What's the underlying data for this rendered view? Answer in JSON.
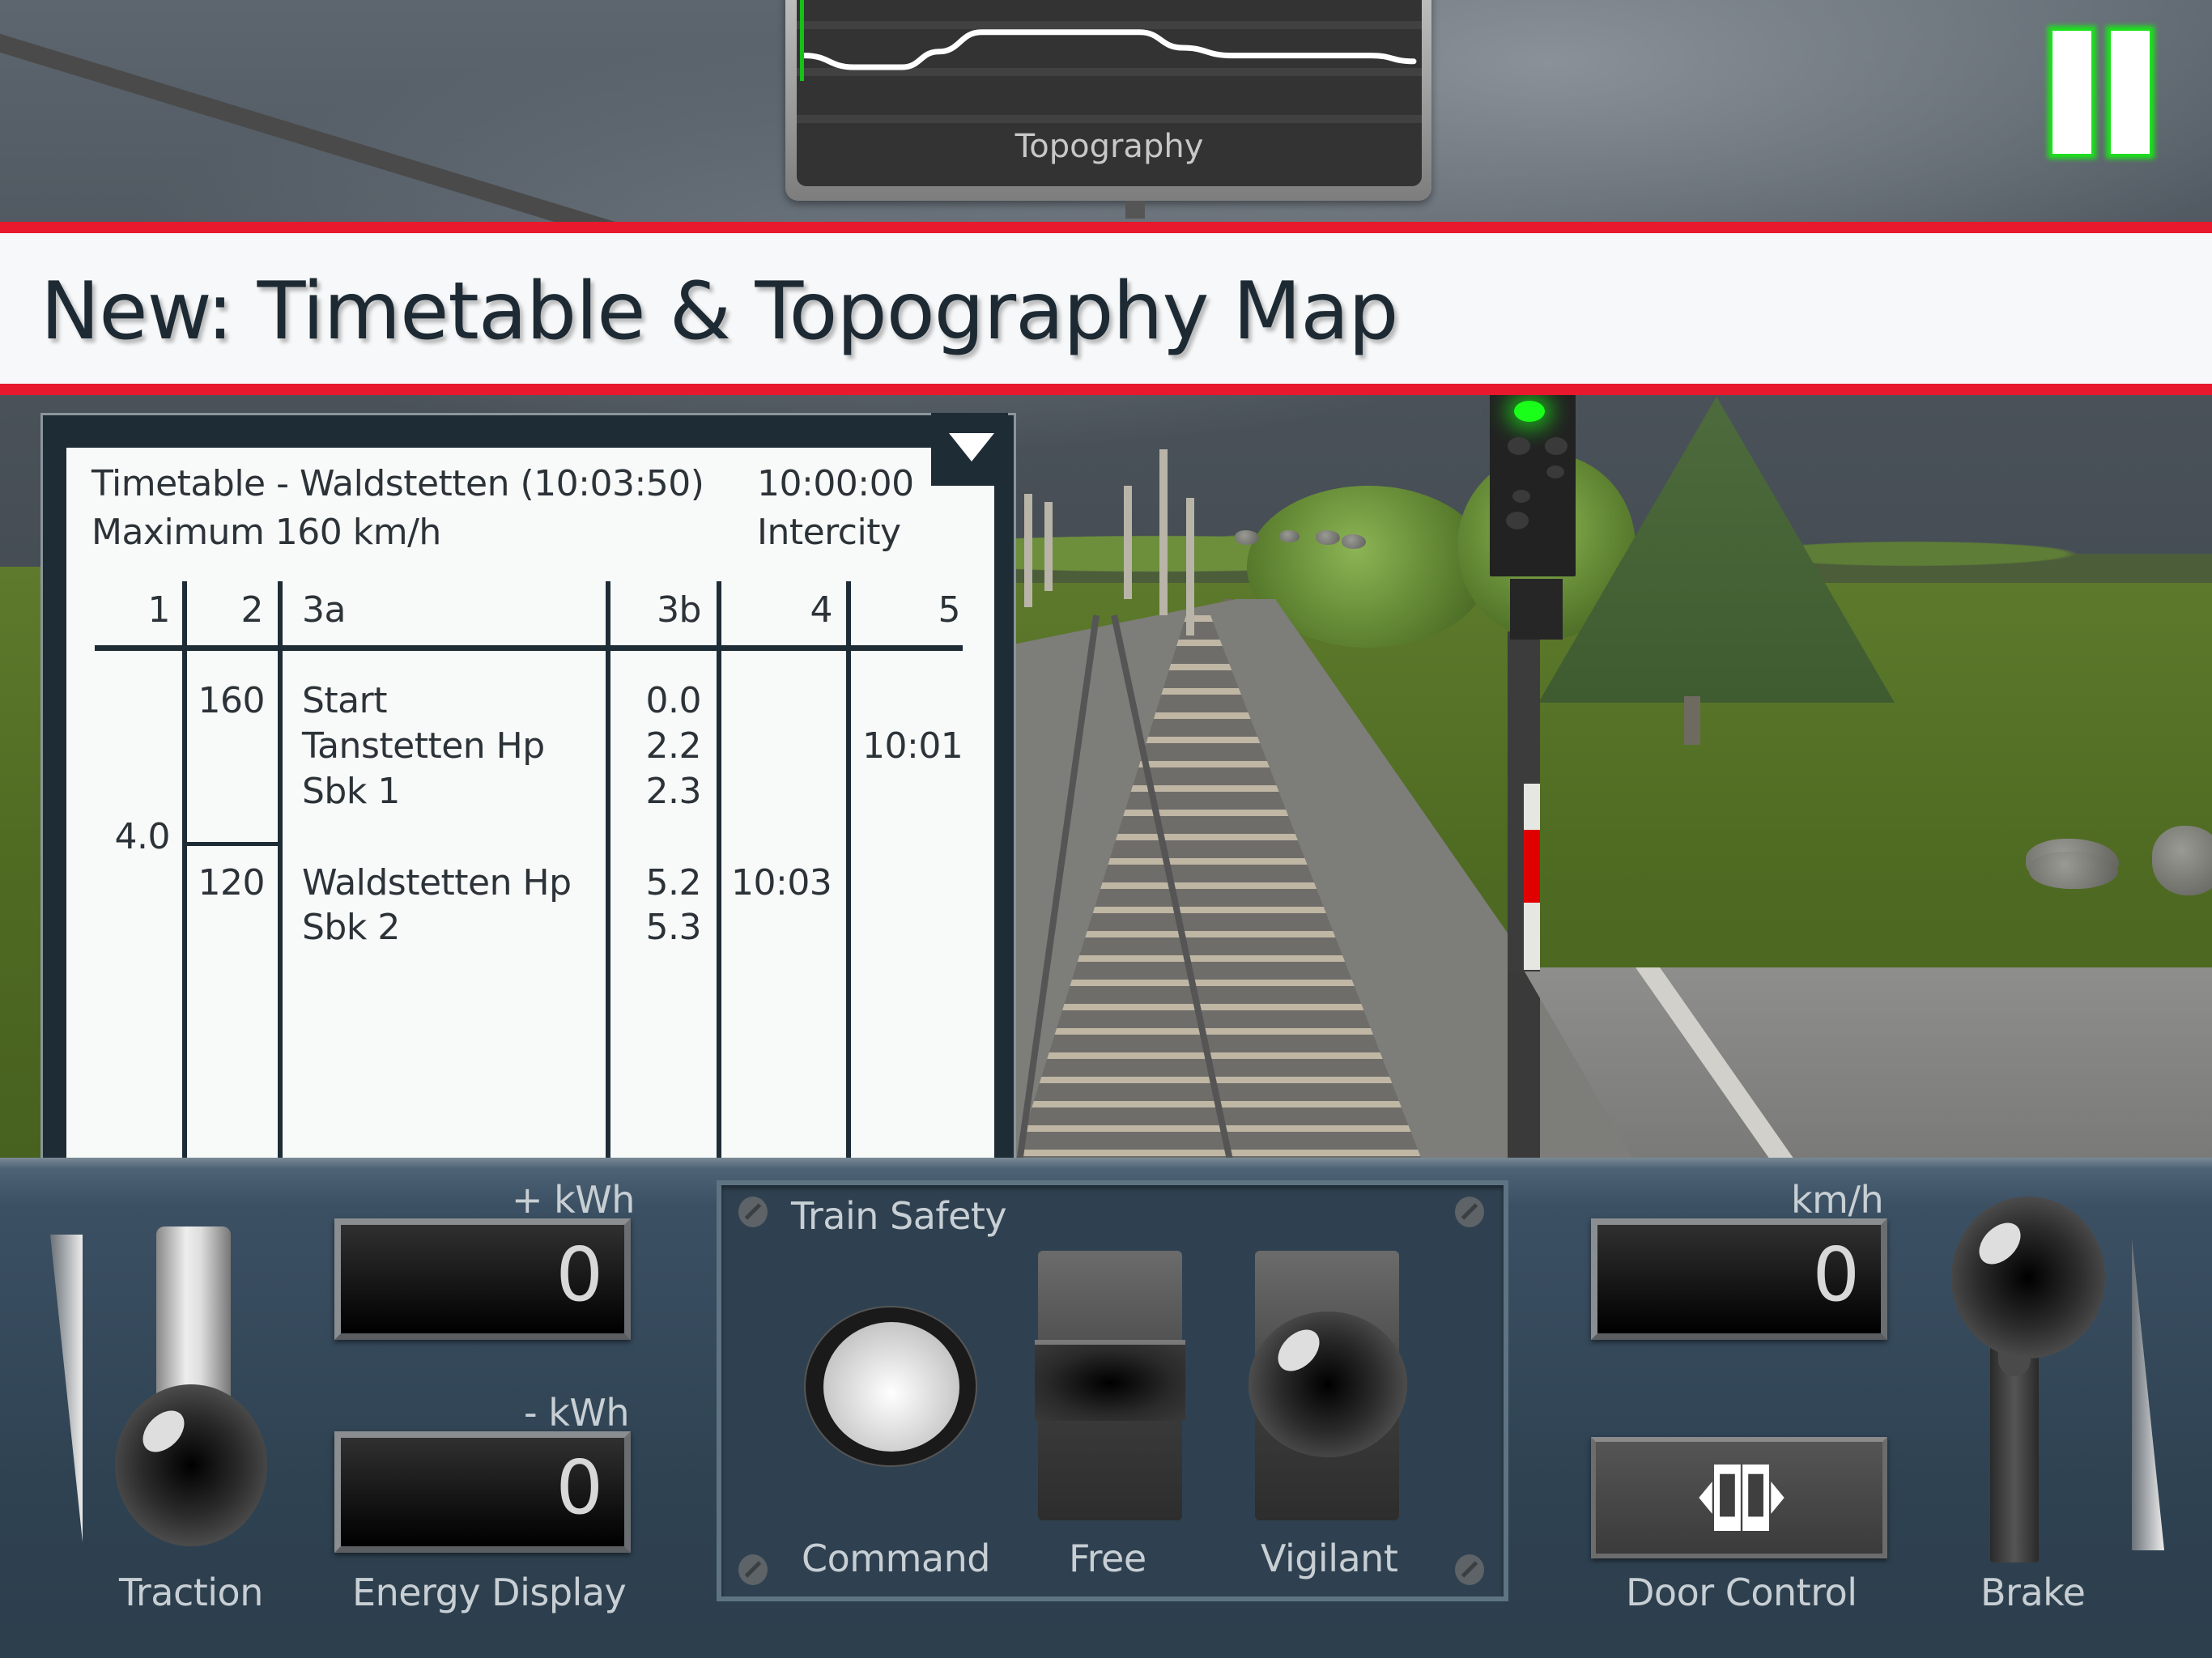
{
  "banner": {
    "title": "New: Timetable & Topography Map",
    "accent_color": "#e8182d"
  },
  "topography": {
    "label": "Topography",
    "profile_points": [
      [
        0,
        0.36
      ],
      [
        0.08,
        0.3
      ],
      [
        0.16,
        0.3
      ],
      [
        0.22,
        0.38
      ],
      [
        0.29,
        0.48
      ],
      [
        0.55,
        0.48
      ],
      [
        0.62,
        0.4
      ],
      [
        0.7,
        0.36
      ],
      [
        0.93,
        0.36
      ],
      [
        1.0,
        0.33
      ]
    ],
    "position_marker_color": "#16c016"
  },
  "pause": {
    "icon": "pause-icon",
    "glow_color": "#19e619"
  },
  "timetable": {
    "title": "Timetable - Waldstetten (10:03:50)",
    "subtitle": "Maximum 160 km/h",
    "clock": "10:00:00",
    "train_type": "Intercity",
    "collapse_icon": "triangle-down-icon",
    "columns": [
      "1",
      "2",
      "3a",
      "3b",
      "4",
      "5"
    ],
    "col1_value": "4.0",
    "speed_sections": [
      "160",
      "120"
    ],
    "rows": [
      {
        "station": "Start",
        "km": "0.0",
        "arrival": "",
        "departure": ""
      },
      {
        "station": "Tanstetten Hp",
        "km": "2.2",
        "arrival": "",
        "departure": "10:01"
      },
      {
        "station": "Sbk 1",
        "km": "2.3",
        "arrival": "",
        "departure": ""
      },
      {
        "station": "Waldstetten Hp",
        "km": "5.2",
        "arrival": "10:03",
        "departure": ""
      },
      {
        "station": "Sbk 2",
        "km": "5.3",
        "arrival": "",
        "departure": ""
      }
    ]
  },
  "signal": {
    "aspect": "green"
  },
  "controls": {
    "traction": {
      "label": "Traction",
      "level": 0
    },
    "energy": {
      "label": "Energy Display",
      "plus_label": "+ kWh",
      "plus_value": "0",
      "minus_label": "- kWh",
      "minus_value": "0"
    },
    "train_safety": {
      "title": "Train Safety",
      "command_label": "Command",
      "free_label": "Free",
      "vigilant_label": "Vigilant"
    },
    "speed": {
      "unit": "km/h",
      "value": "0"
    },
    "door": {
      "label": "Door Control",
      "icon": "door-open-icon"
    },
    "brake": {
      "label": "Brake",
      "level": 0
    }
  }
}
